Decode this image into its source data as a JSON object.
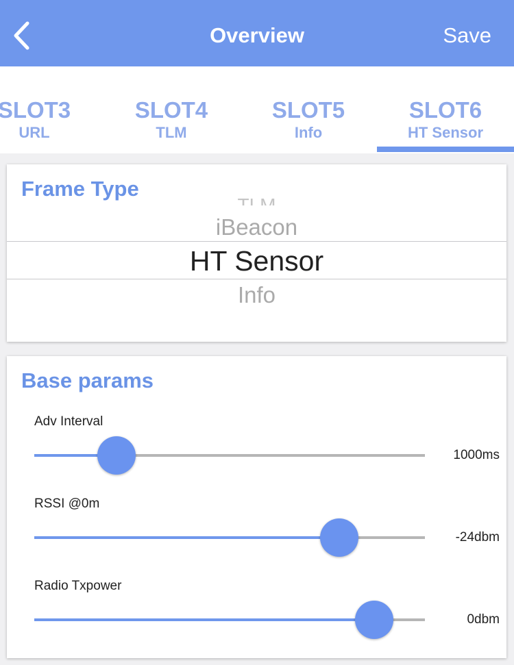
{
  "navbar": {
    "title": "Overview",
    "save_label": "Save",
    "back_icon": "chevron-left-icon"
  },
  "tabs": [
    {
      "slot": "SLOT3",
      "type": "URL",
      "selected": false
    },
    {
      "slot": "SLOT4",
      "type": "TLM",
      "selected": false
    },
    {
      "slot": "SLOT5",
      "type": "Info",
      "selected": false
    },
    {
      "slot": "SLOT6",
      "type": "HT Sensor",
      "selected": true
    }
  ],
  "frame_type": {
    "title": "Frame Type",
    "options_above": [
      "TLM",
      "iBeacon"
    ],
    "selected": "HT Sensor",
    "options_below": [
      "Info"
    ]
  },
  "base_params": {
    "title": "Base params",
    "adv_interval": {
      "label": "Adv Interval",
      "value": "1000ms",
      "position": 0.21
    },
    "rssi": {
      "label": "RSSI @0m",
      "value": "-24dbm",
      "position": 0.78
    },
    "tx_power": {
      "label": "Radio Txpower",
      "value": "0dbm",
      "position": 0.87
    }
  },
  "colors": {
    "accent": "#6f97ec",
    "tab_text": "#8faaea",
    "section_title": "#6a93e6"
  }
}
